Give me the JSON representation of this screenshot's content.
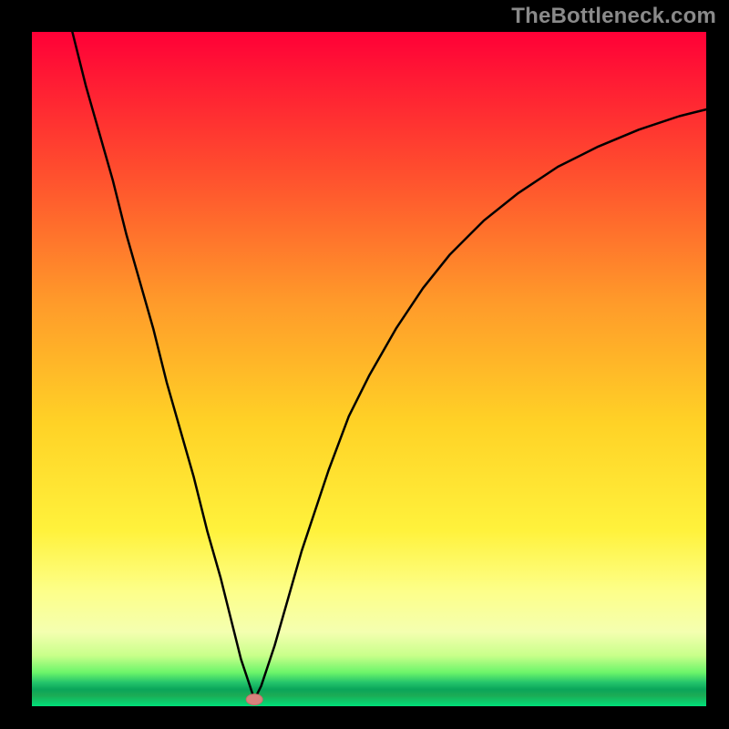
{
  "watermark": "TheBottleneck.com",
  "colors": {
    "frame": "#000000",
    "curve": "#000000",
    "marker_fill": "#d9827d",
    "marker_stroke": "#c46e6a",
    "gradient": {
      "top": "#ff0037",
      "mid_upper": "#ff7a2a",
      "mid": "#ffd226",
      "mid_lower": "#fff84a",
      "band": "#fdff8a",
      "green_top": "#8cff60",
      "green_band": "#1cab55",
      "green_bottom": "#00e07a"
    }
  },
  "chart_data": {
    "type": "line",
    "title": "",
    "xlabel": "",
    "ylabel": "",
    "xlim": [
      0,
      100
    ],
    "ylim": [
      0,
      100
    ],
    "note": "Axis values are relative (no tick labels are shown in the image). The V-shaped curve reaches its minimum near x≈33 at y≈0, rising steeply on both sides. A small pink marker sits at the minimum.",
    "series": [
      {
        "name": "bottleneck-curve",
        "x": [
          6,
          8,
          10,
          12,
          14,
          16,
          18,
          20,
          22,
          24,
          26,
          28,
          30,
          31,
          32,
          33,
          34,
          35,
          36,
          38,
          40,
          42,
          44,
          47,
          50,
          54,
          58,
          62,
          67,
          72,
          78,
          84,
          90,
          96,
          100
        ],
        "y": [
          100,
          92,
          85,
          78,
          70,
          63,
          56,
          48,
          41,
          34,
          26,
          19,
          11,
          7,
          4,
          1,
          3,
          6,
          9,
          16,
          23,
          29,
          35,
          43,
          49,
          56,
          62,
          67,
          72,
          76,
          80,
          83,
          85.5,
          87.5,
          88.5
        ]
      }
    ],
    "marker": {
      "x": 33,
      "y": 1
    }
  }
}
